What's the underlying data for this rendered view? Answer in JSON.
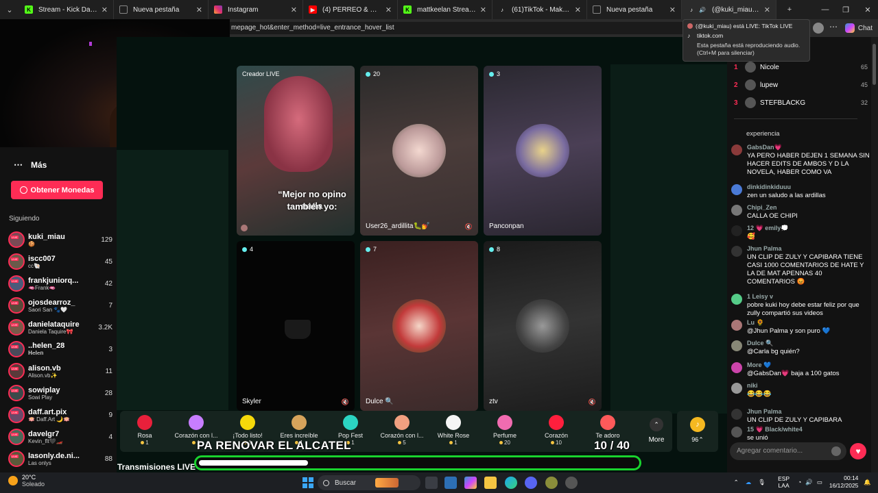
{
  "browser": {
    "tabs": [
      {
        "title": "Stream - Kick Dashboard",
        "icon": "kick-icon",
        "color": "#53fc18"
      },
      {
        "title": "Nueva pestaña",
        "icon": "page-icon",
        "color": "#888888"
      },
      {
        "title": "Instagram",
        "icon": "instagram-icon",
        "color": "#e1306c"
      },
      {
        "title": "(4) PERREO & REGGAETON",
        "icon": "youtube-icon",
        "color": "#ff0000"
      },
      {
        "title": "mattkeelan Stream - Watch",
        "icon": "kick-icon",
        "color": "#53fc18"
      },
      {
        "title": "(61)TikTok - Make Your Day",
        "icon": "tiktok-icon",
        "color": "#ffffff"
      },
      {
        "title": "Nueva pestaña",
        "icon": "page-icon",
        "color": "#888888"
      },
      {
        "title": "(@kuki_miau) está LIVE",
        "icon": "tiktok-icon",
        "color": "#ffffff"
      }
    ],
    "url": "mepage_hot&enter_method=live_entrance_hover_list",
    "chat_label": "Chat",
    "tooltip": {
      "title": "(@kuki_miau) está LIVE: TikTok LIVE",
      "domain": "tiktok.com",
      "audio_line1": "Esta pestaña está reproduciendo audio.",
      "audio_line2": "(Ctrl+M para silenciar)"
    }
  },
  "sidebar": {
    "more_label": "Más",
    "coins_button": "Obtener Monedas",
    "following_title": "Siguiendo",
    "following": [
      {
        "name": "kuki_miau",
        "sub": "🍪",
        "count": "129"
      },
      {
        "name": "iscc007",
        "sub": "cc🐚",
        "count": "45"
      },
      {
        "name": "frankjuniorq...",
        "sub": "🫦Frank🫦",
        "count": "42"
      },
      {
        "name": "ojosdearroz_",
        "sub": "Saori San 🐾🤍",
        "count": "7"
      },
      {
        "name": "danielataquire",
        "sub": "Daniela Taquire🎀",
        "count": "3.2K"
      },
      {
        "name": "..helen_28",
        "sub": "𝐇𝐞𝐥𝐞𝐧",
        "count": "3"
      },
      {
        "name": "alison.vb",
        "sub": "Alison.vb✨",
        "count": "11"
      },
      {
        "name": "sowiplay",
        "sub": "Sowi Play",
        "count": "28"
      },
      {
        "name": "daff.art.pix",
        "sub": "🪷 Daff.Art 🌙🪷",
        "count": "9"
      },
      {
        "name": "davelgr7",
        "sub": "Kevin_flt🖤🏎️",
        "count": "4"
      },
      {
        "name": "lasonly.de.ni...",
        "sub": "Las onlys",
        "count": "88"
      }
    ]
  },
  "main": {
    "tiles": [
      {
        "badge": "Creador LIVE",
        "name": "",
        "caption1": "“Mejor no opino nada",
        "caption2": "también yo:",
        "muted": false
      },
      {
        "badge": "20",
        "name": "User26_ardillita🐛💅",
        "muted": true
      },
      {
        "badge": "3",
        "name": "Panconpan",
        "muted": false
      },
      {
        "badge": "4",
        "name": "Skyler",
        "muted": true
      },
      {
        "badge": "7",
        "name": "Dulce 🔍",
        "muted": false
      },
      {
        "badge": "8",
        "name": "ztv",
        "muted": true
      }
    ],
    "gifts": [
      {
        "label": "Rosa",
        "price": "1",
        "color": "#e8203b"
      },
      {
        "label": "Corazón con l...",
        "price": "1",
        "color": "#c77dff"
      },
      {
        "label": "¡Todo listo!",
        "price": "1",
        "color": "#f5d90a"
      },
      {
        "label": "Eres increíble",
        "price": "1",
        "color": "#d6a35b"
      },
      {
        "label": "Pop Fest",
        "price": "1",
        "color": "#2bd4c2"
      },
      {
        "label": "Corazón con l...",
        "price": "5",
        "color": "#f0a080"
      },
      {
        "label": "White Rose",
        "price": "1",
        "color": "#f5f5f5"
      },
      {
        "label": "Perfume",
        "price": "20",
        "color": "#f06cb0"
      },
      {
        "label": "Corazón",
        "price": "10",
        "color": "#ff1f3d"
      },
      {
        "label": "Te adoro",
        "price": "",
        "color": "#ff5a5a"
      }
    ],
    "more_label": "More",
    "coin_balance": "96⌃",
    "overlay_text": "PA RENOVAR EL ALCATEL",
    "overlay_count": "10 / 40",
    "progress": 0.25,
    "section_title": "Transmisiones LIVE recomendadas"
  },
  "chat": {
    "rank": [
      {
        "n": "1",
        "name": "Nicole",
        "score": "65"
      },
      {
        "n": "2",
        "name": "lupew",
        "score": "45"
      },
      {
        "n": "3",
        "name": "STEFBLACKG",
        "score": "32"
      }
    ],
    "partial": "experiencia",
    "messages": [
      {
        "user": "GabsDan💗",
        "text": "YA PERO HABER DEJEN 1 SEMANA SIN HACER EDITS DE AMBOS Y D LA NOVELA, HABER COMO VA"
      },
      {
        "user": "dinkidinkiduuu",
        "text": "zen un saludo a las ardillas"
      },
      {
        "user": "Chipi_Zen",
        "text": "CALLA OE CHIPI"
      },
      {
        "user": "12 💗 emily💭",
        "text": "🥰"
      },
      {
        "user": "Jhun Palma",
        "text": "UN CLIP DE ZULY Y CAPIBARA TIENE CASI 1000 COMENTARIOS DE HATE Y LA DE MAT APENNAS 40 COMENTARIOS 😡"
      },
      {
        "user": "1 Leisy v",
        "text": "pobre kuki hoy debe estar feliz por que zully compartió sus videos"
      },
      {
        "user": "Lu 🌻",
        "text": "@Jhun Palma y son puro 💙"
      },
      {
        "user": "Dulce 🔍",
        "text": "@Carla bg quién?"
      },
      {
        "user": "More 💙",
        "text": "@GabsDan💗 baja a 100 gatos"
      },
      {
        "user": "niki",
        "text": "😂😂😂"
      },
      {
        "user": "Jhun Palma",
        "text": "UN CLIP DE ZULY Y CAPIBARA"
      },
      {
        "user": "15 💗 Black/white4",
        "text": "se unió"
      }
    ],
    "input_placeholder": "Agregar comentario..."
  },
  "taskbar": {
    "temp": "20°C",
    "weather": "Soleado",
    "search_label": "Buscar",
    "lang1": "ESP",
    "lang2": "LAA",
    "time": "00:14",
    "date": "16/12/2025"
  }
}
